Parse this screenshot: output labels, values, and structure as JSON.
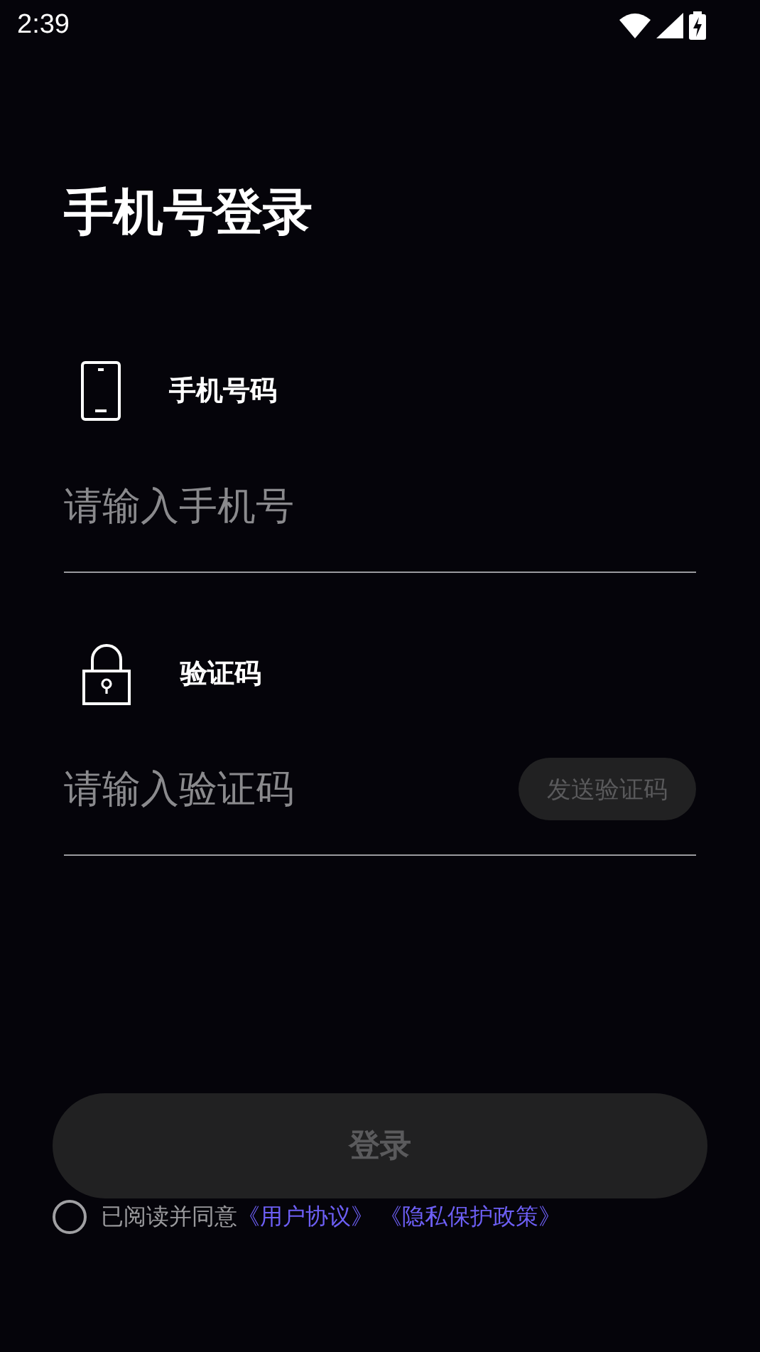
{
  "status_bar": {
    "time": "2:39"
  },
  "title": "手机号登录",
  "fields": [
    {
      "kind": "phone",
      "label": "手机号码",
      "placeholder": "请输入手机号"
    },
    {
      "kind": "code",
      "label": "验证码",
      "placeholder": "请输入验证码",
      "action": {
        "label": "发送验证码",
        "disabled": true
      }
    }
  ],
  "login_button": {
    "label": "登录",
    "disabled": true
  },
  "agreement": {
    "checked": false,
    "text": "已阅读并同意",
    "links": [
      "《用户协议》",
      "《隐私保护政策》"
    ]
  }
}
